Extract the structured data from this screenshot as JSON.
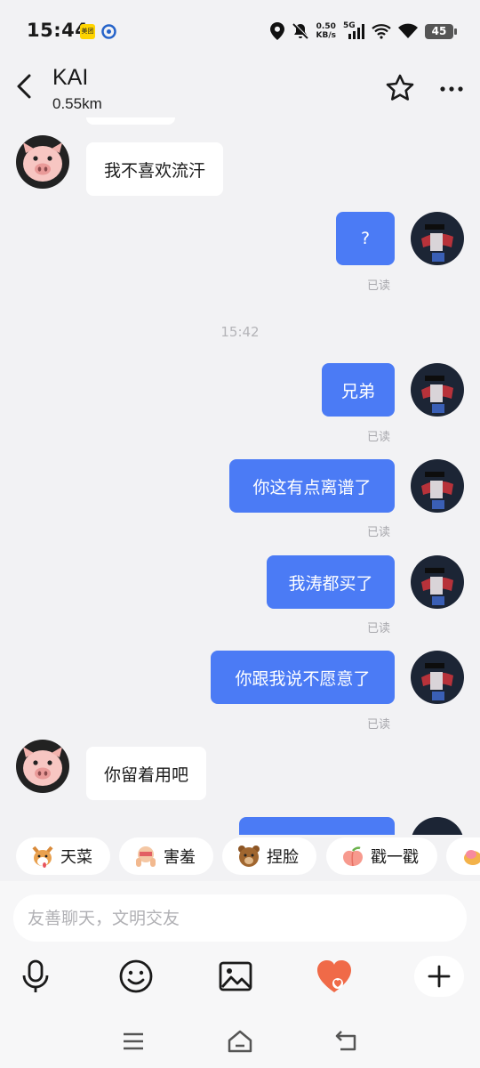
{
  "status_bar": {
    "time": "15:44",
    "app_badge": "美团",
    "net_speed": "0.50",
    "net_unit": "KB/s",
    "network": "5G",
    "battery": "45"
  },
  "header": {
    "contact_name": "KAI",
    "distance": "0.55km"
  },
  "messages": [
    {
      "side": "in",
      "text": "我不喜欢流汗"
    },
    {
      "side": "out",
      "text": "?",
      "read": "已读"
    },
    {
      "type": "time",
      "text": "15:42"
    },
    {
      "side": "out",
      "text": "兄弟",
      "read": "已读"
    },
    {
      "side": "out",
      "text": "你这有点离谱了",
      "read": "已读"
    },
    {
      "side": "out",
      "text": "我涛都买了",
      "read": "已读"
    },
    {
      "side": "out",
      "text": "你跟我说不愿意了",
      "read": "已读"
    },
    {
      "side": "in",
      "text": "你留着用吧"
    }
  ],
  "quick_reactions": [
    {
      "label": "天菜",
      "icon": "dog-emoji-icon"
    },
    {
      "label": "害羞",
      "icon": "shy-emoji-icon"
    },
    {
      "label": "捏脸",
      "icon": "bear-emoji-icon"
    },
    {
      "label": "戳一戳",
      "icon": "peach-emoji-icon"
    }
  ],
  "composer": {
    "placeholder": "友善聊天，文明交友",
    "accent_color": "#4b7bf5"
  },
  "colors": {
    "outgoing_bubble": "#4b7bf5",
    "incoming_bubble": "#ffffff",
    "background": "#f2f2f4"
  }
}
